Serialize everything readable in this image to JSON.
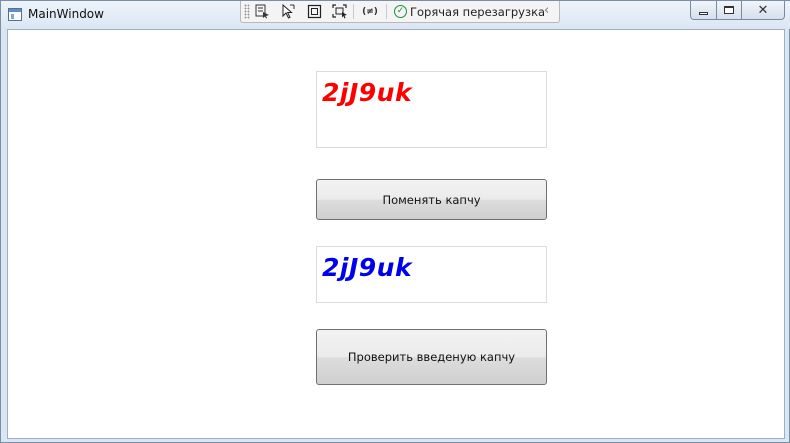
{
  "window": {
    "title": "MainWindow"
  },
  "debug_toolbar": {
    "icons": [
      "select-element-icon",
      "pointer-icon",
      "layout-adorner-icon",
      "track-focus-icon",
      "binding-failures-icon"
    ],
    "binding_label": "(≠)",
    "hot_reload_label": "Горячая перезагрузка",
    "collapse_glyph": "‹"
  },
  "captcha": {
    "generated_text": "2jJ9uk",
    "generated_color": "#ff0000",
    "entered_text": "2jJ9uk",
    "entered_color": "#0000ee"
  },
  "buttons": {
    "change_label": "Поменять капчу",
    "check_label": "Проверить введеную капчу"
  },
  "colors": {
    "client_background": "#ffffff",
    "frame": "#dbe6f3"
  }
}
